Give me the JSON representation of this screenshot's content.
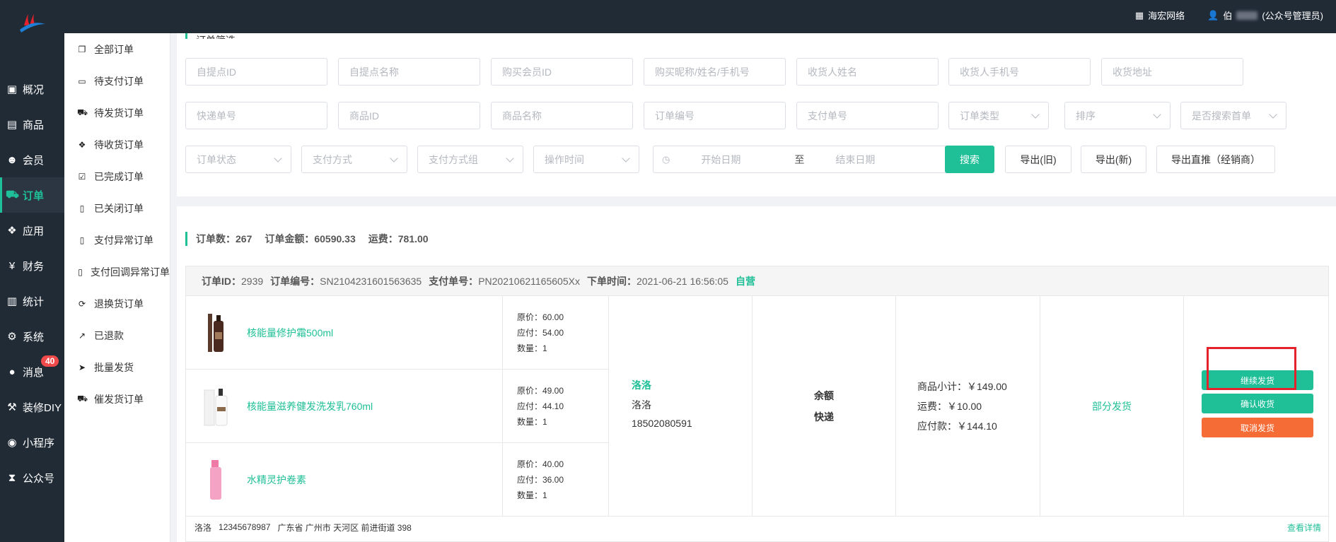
{
  "topbar": {
    "store": "海宏网络",
    "user_prefix": "伯",
    "user_role": "(公众号管理员)"
  },
  "leftnav": [
    {
      "label": "概况",
      "icon": "dashboard-icon"
    },
    {
      "label": "商品",
      "icon": "goods-icon"
    },
    {
      "label": "会员",
      "icon": "users-icon"
    },
    {
      "label": "订单",
      "icon": "cart-icon"
    },
    {
      "label": "应用",
      "icon": "apps-icon"
    },
    {
      "label": "财务",
      "icon": "yen-icon"
    },
    {
      "label": "统计",
      "icon": "bar-chart-icon"
    },
    {
      "label": "系统",
      "icon": "gear-icon"
    },
    {
      "label": "消息",
      "icon": "message-icon",
      "badge": "40"
    },
    {
      "label": "装修DIY",
      "icon": "hammer-icon"
    },
    {
      "label": "小程序",
      "icon": "wechat-icon"
    },
    {
      "label": "公众号",
      "icon": "hourglass-icon"
    }
  ],
  "subnav": [
    {
      "label": "全部订单"
    },
    {
      "label": "待支付订单"
    },
    {
      "label": "待发货订单"
    },
    {
      "label": "待收货订单"
    },
    {
      "label": "已完成订单"
    },
    {
      "label": "已关闭订单"
    },
    {
      "label": "支付异常订单"
    },
    {
      "label": "支付回调异常订单"
    },
    {
      "label": "退换货订单"
    },
    {
      "label": "已退款"
    },
    {
      "label": "批量发货"
    },
    {
      "label": "催发货订单"
    }
  ],
  "filter": {
    "title": "订单筛选",
    "row1": [
      "自提点ID",
      "自提点名称",
      "购买会员ID",
      "购买昵称/姓名/手机号",
      "收货人姓名",
      "收货人手机号",
      "收货地址"
    ],
    "row2": [
      "快递单号",
      "商品ID",
      "商品名称",
      "订单编号",
      "支付单号"
    ],
    "row2_selects": [
      "订单类型",
      "排序",
      "是否搜索首单"
    ],
    "row3_selects": [
      "订单状态",
      "支付方式",
      "支付方式组",
      "操作时间"
    ],
    "date": {
      "start": "开始日期",
      "sep": "至",
      "end": "结束日期"
    },
    "buttons": {
      "search": "搜索",
      "export_old": "导出(旧)",
      "export_new": "导出(新)",
      "export_direct": "导出直推（经销商）"
    }
  },
  "stats": {
    "count": "订单数：267",
    "amount": "订单金额：60590.33",
    "freight": "运费：781.00"
  },
  "order": {
    "id_label": "订单ID：",
    "id": "2939",
    "no_label": "订单编号：",
    "no": "SN2104231601563635",
    "pay_label": "支付单号：",
    "pay": "PN20210621165605Xx",
    "time_label": "下单时间：",
    "time": "2021-06-21 16:56:05",
    "self": "自营",
    "products": [
      {
        "name": "核能量修护霜500ml",
        "orig": "原价：60.00",
        "pay": "应付：54.00",
        "qty": "数量：1"
      },
      {
        "name": "核能量滋养健发洗发乳760ml",
        "orig": "原价：49.00",
        "pay": "应付：44.10",
        "qty": "数量：1"
      },
      {
        "name": "水精灵护卷素",
        "orig": "原价：40.00",
        "pay": "应付：36.00",
        "qty": "数量：1"
      }
    ],
    "buyer": {
      "nick": "洛洛",
      "name": "洛洛",
      "phone": "18502080591"
    },
    "payment": {
      "method": "余额",
      "delivery": "快递"
    },
    "amounts": {
      "subtotal": "商品小计：￥149.00",
      "freight": "运费：￥10.00",
      "payable": "应付款：￥144.10"
    },
    "status": "部分发货",
    "actions": {
      "continue": "继续发货",
      "confirm": "确认收货",
      "cancel": "取消发货"
    },
    "address": {
      "name": "洛洛",
      "phone": "12345678987",
      "addr": "广东省 广州市 天河区 前进街道 398",
      "detail": "查看详情"
    }
  }
}
